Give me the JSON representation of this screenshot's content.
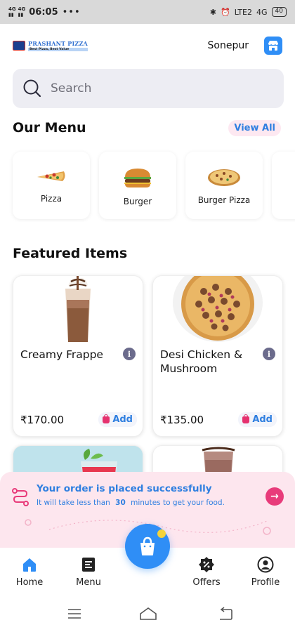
{
  "status_bar": {
    "time": "06:05",
    "signal_1": "4G",
    "signal_2": "4G",
    "lte": "LTE2",
    "net": "4G",
    "battery": "40"
  },
  "header": {
    "logo_name": "PRASHANT PIZZA",
    "logo_tagline": "Best Pizza, Best Value",
    "location": "Sonepur"
  },
  "search": {
    "placeholder": "Search"
  },
  "our_menu": {
    "title": "Our Menu",
    "view_all": "View All",
    "items": [
      {
        "label": "Pizza"
      },
      {
        "label": "Burger"
      },
      {
        "label": "Burger Pizza"
      }
    ]
  },
  "featured": {
    "title": "Featured Items",
    "items": [
      {
        "name": "Creamy Frappe",
        "price": "₹170.00",
        "add_label": "Add"
      },
      {
        "name": "Desi Chicken & Mushroom",
        "price": "₹135.00",
        "add_label": "Add"
      }
    ]
  },
  "order_banner": {
    "title": "Your order is placed successfully",
    "sub_prefix": "It will take less than",
    "minutes": "30",
    "sub_suffix": "minutes to get your food."
  },
  "bottom_nav": {
    "home": "Home",
    "menu": "Menu",
    "offers": "Offers",
    "profile": "Profile"
  },
  "colors": {
    "accent": "#2f8ef6",
    "pink": "#e83b7a",
    "banner_bg": "#fde6ee"
  }
}
